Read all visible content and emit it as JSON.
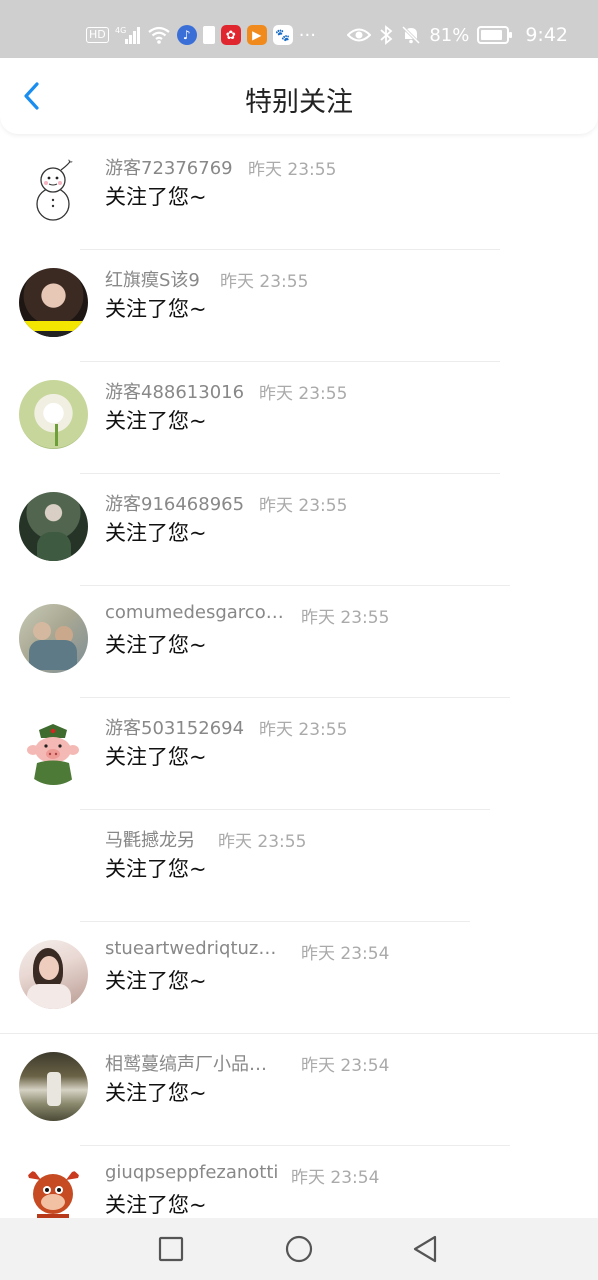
{
  "status_bar": {
    "network_badge": "HD",
    "signal_label": "4G",
    "battery_percent": "81%",
    "time": "9:42",
    "icons": [
      "hd-badge-icon",
      "signal-icon",
      "wifi-icon",
      "app-icon-music",
      "sim-icon",
      "app-huawei-icon",
      "app-video-icon",
      "app-baidu-icon",
      "more-icon",
      "eye-icon",
      "bluetooth-icon",
      "mute-icon",
      "battery-icon"
    ]
  },
  "header": {
    "title": "特别关注",
    "back_icon": "chevron-left-icon",
    "accent_color": "#1a8ef0"
  },
  "rows": [
    {
      "name": "游客72376769",
      "time": "昨天 23:55",
      "message": "关注了您~",
      "avatar": "snowman"
    },
    {
      "name": "红旗瘼S该9",
      "time": "昨天 23:55",
      "message": "关注了您~",
      "avatar": "girl-photo"
    },
    {
      "name": "游客488613016",
      "time": "昨天 23:55",
      "message": "关注了您~",
      "avatar": "lotus"
    },
    {
      "name": "游客916468965",
      "time": "昨天 23:55",
      "message": "关注了您~",
      "avatar": "man-rain"
    },
    {
      "name": "comumedesgarco…",
      "time": "昨天 23:55",
      "message": "关注了您~",
      "avatar": "couple-photo"
    },
    {
      "name": "游客503152694",
      "time": "昨天 23:55",
      "message": "关注了您~",
      "avatar": "pig-soldier"
    },
    {
      "name": "马氍撼龙另",
      "time": "昨天 23:55",
      "message": "关注了您~",
      "avatar": "none"
    },
    {
      "name": "stueartwedriqtuz…",
      "time": "昨天 23:54",
      "message": "关注了您~",
      "avatar": "woman-photo"
    },
    {
      "name": "相鹫蔓缟声厂小品…",
      "time": "昨天 23:54",
      "message": "关注了您~",
      "avatar": "waterfall"
    },
    {
      "name": "giuqpseppfezanotti",
      "time": "昨天 23:54",
      "message": "关注了您~",
      "avatar": "ox-cartoon"
    }
  ],
  "nav_bar": {
    "icons": [
      "square-recents-icon",
      "circle-home-icon",
      "triangle-back-icon"
    ]
  }
}
